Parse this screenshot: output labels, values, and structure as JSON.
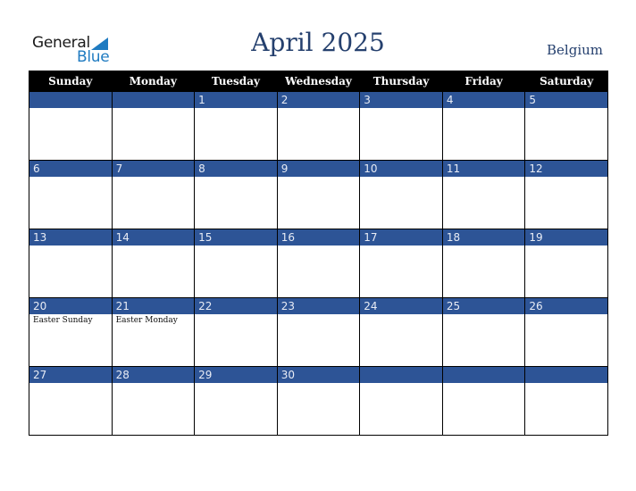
{
  "logo": {
    "word1": "General",
    "word2": "Blue"
  },
  "title": "April 2025",
  "country": "Belgium",
  "colors": {
    "header_bg": "#000000",
    "date_bar": "#2d5496",
    "title": "#25406e",
    "logo_blue": "#1f7bc1"
  },
  "weekdays": [
    "Sunday",
    "Monday",
    "Tuesday",
    "Wednesday",
    "Thursday",
    "Friday",
    "Saturday"
  ],
  "weeks": [
    [
      {
        "day": "",
        "holiday": ""
      },
      {
        "day": "",
        "holiday": ""
      },
      {
        "day": "1",
        "holiday": ""
      },
      {
        "day": "2",
        "holiday": ""
      },
      {
        "day": "3",
        "holiday": ""
      },
      {
        "day": "4",
        "holiday": ""
      },
      {
        "day": "5",
        "holiday": ""
      }
    ],
    [
      {
        "day": "6",
        "holiday": ""
      },
      {
        "day": "7",
        "holiday": ""
      },
      {
        "day": "8",
        "holiday": ""
      },
      {
        "day": "9",
        "holiday": ""
      },
      {
        "day": "10",
        "holiday": ""
      },
      {
        "day": "11",
        "holiday": ""
      },
      {
        "day": "12",
        "holiday": ""
      }
    ],
    [
      {
        "day": "13",
        "holiday": ""
      },
      {
        "day": "14",
        "holiday": ""
      },
      {
        "day": "15",
        "holiday": ""
      },
      {
        "day": "16",
        "holiday": ""
      },
      {
        "day": "17",
        "holiday": ""
      },
      {
        "day": "18",
        "holiday": ""
      },
      {
        "day": "19",
        "holiday": ""
      }
    ],
    [
      {
        "day": "20",
        "holiday": "Easter Sunday"
      },
      {
        "day": "21",
        "holiday": "Easter Monday"
      },
      {
        "day": "22",
        "holiday": ""
      },
      {
        "day": "23",
        "holiday": ""
      },
      {
        "day": "24",
        "holiday": ""
      },
      {
        "day": "25",
        "holiday": ""
      },
      {
        "day": "26",
        "holiday": ""
      }
    ],
    [
      {
        "day": "27",
        "holiday": ""
      },
      {
        "day": "28",
        "holiday": ""
      },
      {
        "day": "29",
        "holiday": ""
      },
      {
        "day": "30",
        "holiday": ""
      },
      {
        "day": "",
        "holiday": ""
      },
      {
        "day": "",
        "holiday": ""
      },
      {
        "day": "",
        "holiday": ""
      }
    ]
  ]
}
